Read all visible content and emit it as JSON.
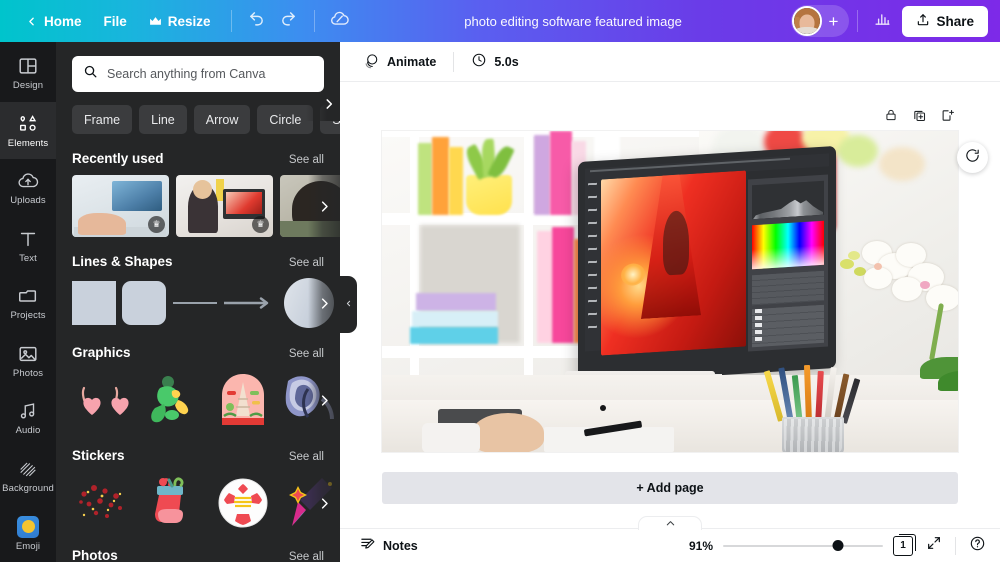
{
  "topbar": {
    "back_icon": "chevron-left-icon",
    "home_label": "Home",
    "file_label": "File",
    "resize_label": "Resize",
    "resize_icon": "crown-icon",
    "undo_icon": "undo-icon",
    "redo_icon": "redo-icon",
    "cloud_icon": "cloud-saved-icon",
    "doc_title": "photo editing software featured image",
    "avatar_icon": "user-avatar",
    "add_collaborator_label": "+",
    "insights_icon": "bar-chart-icon",
    "share_label": "Share",
    "share_icon": "upload-icon",
    "gradient_start": "#00c4cc",
    "gradient_end": "#7d2ae8"
  },
  "rail": {
    "items": [
      {
        "label": "Design",
        "icon": "layout-icon",
        "active": false
      },
      {
        "label": "Elements",
        "icon": "shapes-icon",
        "active": true
      },
      {
        "label": "Uploads",
        "icon": "cloud-up-icon",
        "active": false
      },
      {
        "label": "Text",
        "icon": "text-t-icon",
        "active": false
      },
      {
        "label": "Projects",
        "icon": "folder-icon",
        "active": false
      },
      {
        "label": "Photos",
        "icon": "image-icon",
        "active": false
      },
      {
        "label": "Audio",
        "icon": "music-note-icon",
        "active": false
      },
      {
        "label": "Background",
        "icon": "hatch-icon",
        "active": false
      },
      {
        "label": "Emoji",
        "icon": "emoji-icon",
        "active": false
      }
    ]
  },
  "panel": {
    "search": {
      "placeholder": "Search anything from Canva",
      "value": "",
      "icon": "search-icon"
    },
    "chips": [
      "Frame",
      "Line",
      "Arrow",
      "Circle",
      "Square"
    ],
    "chips_next_icon": "chevron-right-icon",
    "sections": [
      {
        "title": "Recently used",
        "see_all": "See all"
      },
      {
        "title": "Lines & Shapes",
        "see_all": "See all"
      },
      {
        "title": "Graphics",
        "see_all": "See all"
      },
      {
        "title": "Stickers",
        "see_all": "See all"
      },
      {
        "title": "Photos",
        "see_all": "See all"
      }
    ],
    "collapse_icon": "chevron-left-icon"
  },
  "context_bar": {
    "animate_label": "Animate",
    "animate_icon": "animate-icon",
    "duration_label": "5.0s",
    "duration_icon": "clock-icon"
  },
  "canvas": {
    "page_tools": [
      {
        "icon": "lock-icon",
        "name": "lock-page-button"
      },
      {
        "icon": "duplicate-icon",
        "name": "duplicate-page-button"
      },
      {
        "icon": "add-page-icon",
        "name": "insert-page-button"
      }
    ],
    "comment_icon": "add-comment-icon",
    "add_page_label": "+ Add page"
  },
  "bottombar": {
    "notes_label": "Notes",
    "notes_icon": "notes-icon",
    "zoom_level": "91%",
    "zoom_percent": 91,
    "page_number": "1",
    "pages_icon": "grid-pages-icon",
    "fullscreen_icon": "fullscreen-icon",
    "help_icon": "help-icon",
    "expand_icon": "chevron-up-icon"
  }
}
